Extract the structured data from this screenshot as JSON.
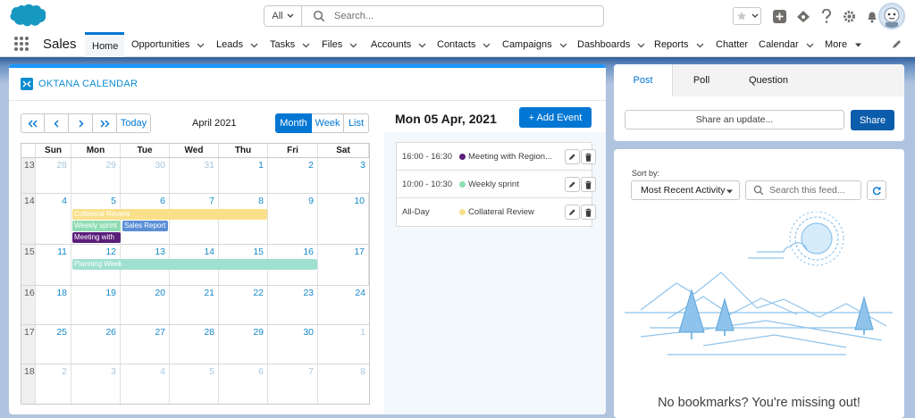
{
  "search": {
    "scope": "All",
    "placeholder": "Search..."
  },
  "app": {
    "name": "Sales"
  },
  "nav": [
    {
      "label": "Home",
      "chevron": false,
      "active": true
    },
    {
      "label": "Opportunities",
      "chevron": true
    },
    {
      "label": "Leads",
      "chevron": true
    },
    {
      "label": "Tasks",
      "chevron": true
    },
    {
      "label": "Files",
      "chevron": true
    },
    {
      "label": "Accounts",
      "chevron": true
    },
    {
      "label": "Contacts",
      "chevron": true
    },
    {
      "label": "Campaigns",
      "chevron": true
    },
    {
      "label": "Dashboards",
      "chevron": true
    },
    {
      "label": "Reports",
      "chevron": true
    },
    {
      "label": "Chatter",
      "chevron": false
    },
    {
      "label": "Calendar",
      "chevron": true
    },
    {
      "label": "More",
      "chevron": true
    }
  ],
  "calendar": {
    "title": "OKTANA CALENDAR",
    "month_label": "April 2021",
    "today_label": "Today",
    "views": {
      "month": "Month",
      "week": "Week",
      "list": "List"
    },
    "day_names": [
      "Sun",
      "Mon",
      "Tue",
      "Wed",
      "Thu",
      "Fri",
      "Sat"
    ],
    "weeks": [
      {
        "wk": "13",
        "days": [
          {
            "n": "28",
            "out": true
          },
          {
            "n": "29",
            "out": true
          },
          {
            "n": "30",
            "out": true
          },
          {
            "n": "31",
            "out": true
          },
          {
            "n": "1"
          },
          {
            "n": "2"
          },
          {
            "n": "3"
          }
        ]
      },
      {
        "wk": "14",
        "days": [
          {
            "n": "4"
          },
          {
            "n": "5"
          },
          {
            "n": "6"
          },
          {
            "n": "7"
          },
          {
            "n": "8"
          },
          {
            "n": "9"
          },
          {
            "n": "10"
          }
        ]
      },
      {
        "wk": "15",
        "days": [
          {
            "n": "11"
          },
          {
            "n": "12"
          },
          {
            "n": "13"
          },
          {
            "n": "14"
          },
          {
            "n": "15"
          },
          {
            "n": "16"
          },
          {
            "n": "17"
          }
        ]
      },
      {
        "wk": "16",
        "days": [
          {
            "n": "18"
          },
          {
            "n": "19"
          },
          {
            "n": "20"
          },
          {
            "n": "21"
          },
          {
            "n": "22"
          },
          {
            "n": "23"
          },
          {
            "n": "24"
          }
        ]
      },
      {
        "wk": "17",
        "days": [
          {
            "n": "25"
          },
          {
            "n": "26"
          },
          {
            "n": "27"
          },
          {
            "n": "28"
          },
          {
            "n": "29"
          },
          {
            "n": "30"
          },
          {
            "n": "1",
            "out": true
          }
        ]
      },
      {
        "wk": "18",
        "days": [
          {
            "n": "2",
            "out": true
          },
          {
            "n": "3",
            "out": true
          },
          {
            "n": "4",
            "out": true
          },
          {
            "n": "5",
            "out": true
          },
          {
            "n": "6",
            "out": true
          },
          {
            "n": "7",
            "out": true
          },
          {
            "n": "8",
            "out": true
          }
        ]
      }
    ],
    "events": [
      {
        "label": "Collateral Review",
        "color": "#f9e08b"
      },
      {
        "label": "Weekly sprint",
        "color": "#8fdcb3"
      },
      {
        "label": "Sales Report",
        "color": "#5b8fd6"
      },
      {
        "label": "Meeting with",
        "color": "#5a1e7a"
      },
      {
        "label": "Planning Week",
        "color": "#9fe0d0"
      }
    ],
    "day_title": "Mon 05 Apr, 2021",
    "add_event_label": "+ Add Event",
    "agenda": [
      {
        "time": "16:00 - 16:30",
        "name": "Meeting with Region...",
        "color": "#5a1e7a"
      },
      {
        "time": "10:00 - 10:30",
        "name": "Weekly sprint",
        "color": "#8fdcb3"
      },
      {
        "time": "All-Day",
        "name": "Collateral Review",
        "color": "#f9e08b"
      }
    ]
  },
  "publisher": {
    "tabs": [
      "Post",
      "Poll",
      "Question"
    ],
    "share_placeholder": "Share an update...",
    "share_label": "Share"
  },
  "feed": {
    "sort_label": "Sort by:",
    "sort_value": "Most Recent Activity",
    "search_placeholder": "Search this feed...",
    "empty_text": "No bookmarks? You're missing out!"
  },
  "colors": {
    "brand": "#0176d3",
    "date_link": "#1589c9",
    "share_button": "#0b5cab"
  }
}
